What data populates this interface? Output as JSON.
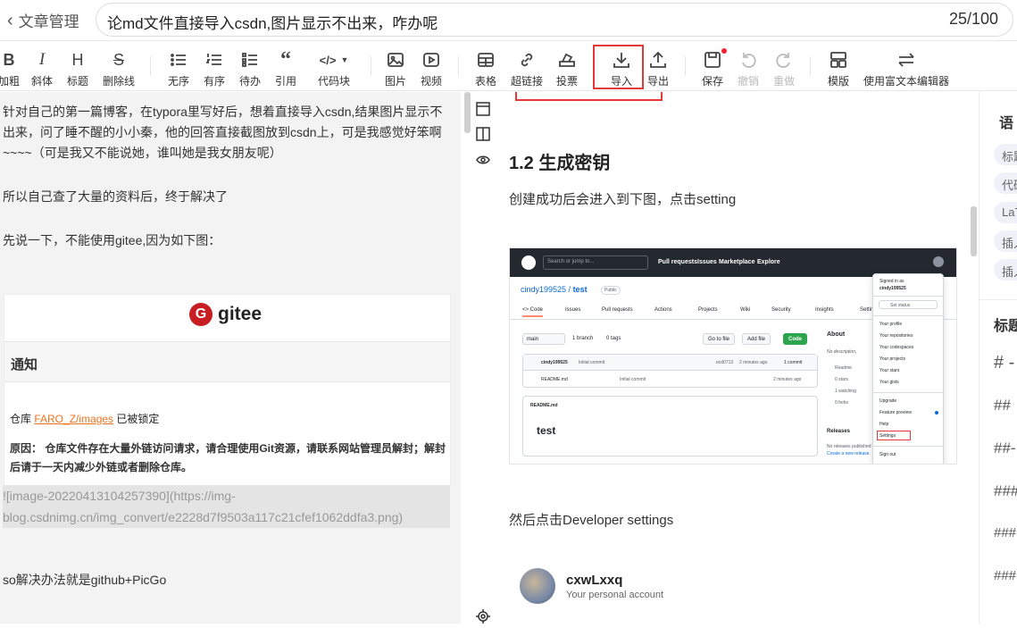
{
  "header": {
    "back_label": "文章管理",
    "title": "论md文件直接导入csdn,图片显示不出来，咋办呢",
    "title_count": "25/100"
  },
  "toolbar": {
    "items": [
      {
        "key": "bold",
        "label": "加粗",
        "icon": "B"
      },
      {
        "key": "italic",
        "label": "斜体",
        "icon": "I"
      },
      {
        "key": "heading",
        "label": "标题",
        "icon": "H"
      },
      {
        "key": "strike",
        "label": "删除线",
        "icon": "S"
      },
      {
        "key": "ul",
        "label": "无序",
        "icon": "list-icon"
      },
      {
        "key": "ol",
        "label": "有序",
        "icon": "ordered-list-icon"
      },
      {
        "key": "todo",
        "label": "待办",
        "icon": "todo-list-icon"
      },
      {
        "key": "quote",
        "label": "引用",
        "icon": "quote-icon"
      },
      {
        "key": "code",
        "label": "代码块",
        "icon": "code-icon"
      },
      {
        "key": "image",
        "label": "图片",
        "icon": "image-icon"
      },
      {
        "key": "video",
        "label": "视频",
        "icon": "video-icon"
      },
      {
        "key": "table",
        "label": "表格",
        "icon": "table-icon"
      },
      {
        "key": "link",
        "label": "超链接",
        "icon": "link-icon"
      },
      {
        "key": "vote",
        "label": "投票",
        "icon": "vote-icon"
      },
      {
        "key": "import",
        "label": "导入",
        "icon": "import-icon"
      },
      {
        "key": "export",
        "label": "导出",
        "icon": "export-icon"
      },
      {
        "key": "save",
        "label": "保存",
        "icon": "save-icon"
      },
      {
        "key": "undo",
        "label": "撤销",
        "icon": "undo-icon"
      },
      {
        "key": "redo",
        "label": "重做",
        "icon": "redo-icon"
      },
      {
        "key": "template",
        "label": "模版",
        "icon": "template-icon"
      },
      {
        "key": "richtext",
        "label": "使用富文本编辑器",
        "icon": "switch-icon"
      }
    ]
  },
  "editor": {
    "p1": "针对自己的第一篇博客，在typora里写好后，想着直接导入csdn,结果图片显示不出来，问了睡不醒的小小秦，他的回答直接截图放到csdn上，可是我感觉好笨啊~~~~（可是我又不能说她，谁叫她是我女朋友呢）",
    "p2": "所以自己查了大量的资料后，终于解决了",
    "p3": "先说一下，不能使用gitee,因为如下图：",
    "gitee": {
      "logo_letter": "G",
      "name": "gitee",
      "notice_title": "通知",
      "repo_prefix": "仓库 ",
      "repo_name": "FARO_Z/images",
      "repo_suffix": " 已被锁定",
      "reason": "原因： 仓库文件存在大量外链访问请求，请合理使用Git资源，请联系网站管理员解封；解封后请于一天内减少外链或者删除仓库。"
    },
    "md_link": "![image-20220413104257390](https://img-blog.csdnimg.cn/img_convert/e2228d7f9503a117c21cfef1062ddfa3.png)",
    "p4": "so解决办法就是github+PicGo"
  },
  "preview": {
    "heading": "1.2 生成密钥",
    "p1": "创建成功后会进入到下图，点击setting",
    "github": {
      "search": "Search or jump to...",
      "nav": [
        "Pull requests",
        "Issues",
        "Marketplace",
        "Explore"
      ],
      "repo_owner": "cindy199525",
      "repo_sep": " / ",
      "repo_name": "test",
      "public": "Public",
      "tabs": [
        "<> Code",
        "Issues",
        "Pull requests",
        "Actions",
        "Projects",
        "Wiki",
        "Security",
        "Insights",
        "Settings"
      ],
      "branch": "main",
      "branches": "1 branch",
      "tags": "0 tags",
      "go_to_file": "Go to file",
      "add_file": "Add file",
      "code_btn": "Code",
      "commit_author": "cindy199525",
      "commit_msg": "Initial commit",
      "commit_hash": "ecd0713",
      "commit_time": "2 minutes ago",
      "commit_count": "1 commit",
      "file_name": "README.md",
      "file_msg": "Initial commit",
      "file_time": "2 minutes ago",
      "readme_title": "README.md",
      "readme_h": "test",
      "about": "About",
      "about_desc": "No description,",
      "about_items": [
        "Readme",
        "0 stars",
        "1 watching",
        "0 forks"
      ],
      "releases": "Releases",
      "releases_desc": "No releases published",
      "releases_link": "Create a new release",
      "dropdown": {
        "signed": "Signed in as",
        "user": "cindy199525",
        "status": "Set status",
        "items1": [
          "Your profile",
          "Your repositories",
          "Your codespaces",
          "Your projects",
          "Your stars",
          "Your gists"
        ],
        "items2": [
          "Upgrade",
          "Feature preview",
          "Help",
          "Settings"
        ],
        "signout": "Sign out"
      }
    },
    "p2": "然后点击Developer settings",
    "account_name": "cxwLxxq",
    "account_sub": "Your personal account"
  },
  "rightpanel": {
    "h1": "语",
    "chips": [
      "标题",
      "代码",
      "LaT",
      "插入",
      "插入"
    ],
    "h2": "标题",
    "hashes": [
      "# -",
      "##",
      "##-",
      "###",
      "###",
      "###"
    ]
  },
  "colors": {
    "accent_red": "#e53935",
    "github_green": "#2da44e",
    "gitee_red": "#c71d23"
  }
}
